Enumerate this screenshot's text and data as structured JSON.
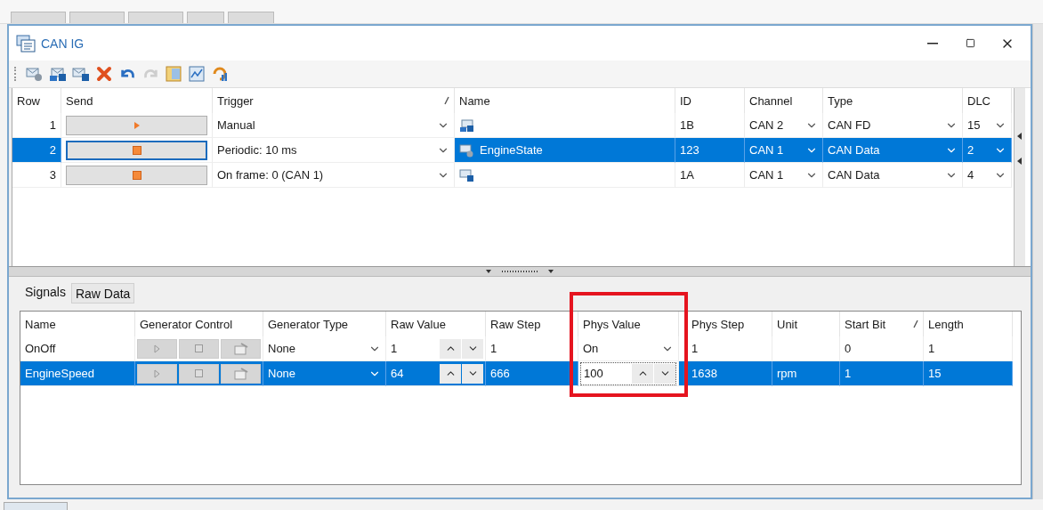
{
  "window": {
    "title": "CAN IG"
  },
  "toolbar": [
    {
      "kind": "message",
      "disabled": false
    },
    {
      "kind": "fd-message",
      "disabled": false
    },
    {
      "kind": "id-message",
      "disabled": false
    },
    {
      "kind": "delete",
      "disabled": false
    },
    {
      "kind": "undo",
      "disabled": false
    },
    {
      "kind": "redo",
      "disabled": true
    },
    {
      "kind": "layout",
      "disabled": false
    },
    {
      "kind": "chart",
      "disabled": false
    },
    {
      "kind": "refresh",
      "disabled": false
    }
  ],
  "messages": {
    "columns": [
      {
        "label": "Row",
        "sorted": false
      },
      {
        "label": "Send",
        "sorted": false
      },
      {
        "label": "Trigger",
        "sorted": true
      },
      {
        "label": "Name",
        "sorted": false
      },
      {
        "label": "ID",
        "sorted": false
      },
      {
        "label": "Channel",
        "sorted": false
      },
      {
        "label": "Type",
        "sorted": false
      },
      {
        "label": "DLC",
        "sorted": false
      }
    ],
    "rows": [
      {
        "row": "1",
        "send": {
          "kind": "play"
        },
        "trigger": "Manual",
        "name": {
          "icon": {
            "kind": "fd-message"
          }
        },
        "id": "1B",
        "channel": "CAN 2",
        "type": "CAN FD",
        "dlc": "15",
        "selected": false
      },
      {
        "row": "2",
        "send": {
          "kind": "stop"
        },
        "trigger": "Periodic: 10 ms",
        "name": {
          "icon": {
            "kind": "db-message"
          },
          "text": "EngineState"
        },
        "id": "123",
        "channel": "CAN 1",
        "type": "CAN Data",
        "dlc": "2",
        "selected": true
      },
      {
        "row": "3",
        "send": {
          "kind": "stop"
        },
        "trigger": "On frame: 0 (CAN 1)",
        "name": {
          "icon": {
            "kind": "id-message"
          }
        },
        "id": "1A",
        "channel": "CAN 1",
        "type": "CAN Data",
        "dlc": "4",
        "selected": false
      }
    ]
  },
  "signal_tabs": [
    {
      "label": "Signals",
      "selected": true
    },
    {
      "label": "Raw Data",
      "selected": false
    }
  ],
  "signals": {
    "columns": [
      {
        "label": "Name",
        "sorted": false,
        "highlighted": false
      },
      {
        "label": "Generator Control",
        "sorted": false,
        "highlighted": false
      },
      {
        "label": "Generator Type",
        "sorted": false,
        "highlighted": false
      },
      {
        "label": "Raw Value",
        "sorted": false,
        "highlighted": false
      },
      {
        "label": "Raw Step",
        "sorted": false,
        "highlighted": false
      },
      {
        "label": "Phys Value",
        "sorted": false,
        "highlighted": true
      },
      {
        "label": "Phys Step",
        "sorted": false,
        "highlighted": false
      },
      {
        "label": "Unit",
        "sorted": false,
        "highlighted": false
      },
      {
        "label": "Start Bit",
        "sorted": true,
        "highlighted": false
      },
      {
        "label": "Length",
        "sorted": false,
        "highlighted": false
      }
    ],
    "rows": [
      {
        "name": "OnOff",
        "generator_disabled": true,
        "generator_type": "None",
        "raw_value": "1",
        "raw_step": "1",
        "phys_value": {
          "kind": "dropdown",
          "value": "On"
        },
        "phys_step": "1",
        "start_bit": "0",
        "length": "1",
        "selected": false
      },
      {
        "name": "EngineSpeed",
        "generator_disabled": true,
        "generator_type": "None",
        "raw_value": "64",
        "raw_step": "666",
        "phys_value": {
          "kind": "spin",
          "value": "100"
        },
        "phys_step": "1638",
        "unit": "rpm",
        "start_bit": "1",
        "length": "15",
        "selected": true
      }
    ]
  }
}
